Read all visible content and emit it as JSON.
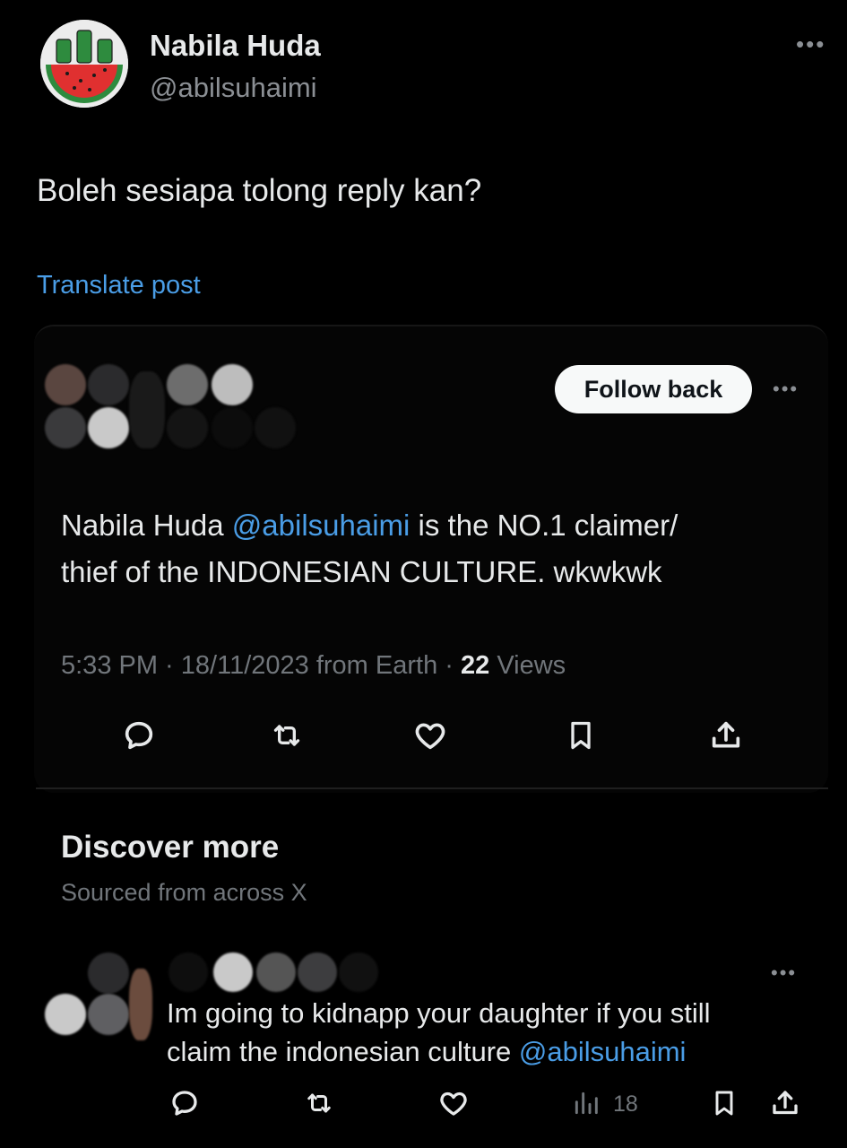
{
  "post": {
    "author_name": "Nabila Huda",
    "author_handle": "@abilsuhaimi",
    "text": "Boleh sesiapa tolong reply kan?",
    "translate_label": "Translate post"
  },
  "quoted": {
    "follow_label": "Follow back",
    "text_before": "Nabila Huda ",
    "mention": "@abilsuhaimi",
    "text_after_line1": " is the NO.1 claimer/",
    "text_line2": "thief of the INDONESIAN CULTURE. wkwkwk",
    "time": "5:33 PM",
    "separator": " · ",
    "date": "18/11/2023",
    "source": " from Earth",
    "views_count": "22",
    "views_label": " Views"
  },
  "discover": {
    "title": "Discover more",
    "subtitle": "Sourced from across X"
  },
  "reply": {
    "line1": "Im going to kidnapp your daughter if you still",
    "line2_text": "claim the indonesian culture ",
    "line2_mention": "@abilsuhaimi",
    "views_count": "18"
  },
  "icons": {
    "more": "more-dots-icon",
    "reply": "reply-icon",
    "retweet": "retweet-icon",
    "like": "heart-icon",
    "bookmark": "bookmark-icon",
    "share": "share-icon",
    "views": "views-chart-icon"
  },
  "colors": {
    "background": "#000000",
    "accent": "#4a9de6",
    "secondary_text": "#71767b",
    "avatar_watermelon": "#e03030",
    "avatar_rind": "#2e8b3e"
  }
}
